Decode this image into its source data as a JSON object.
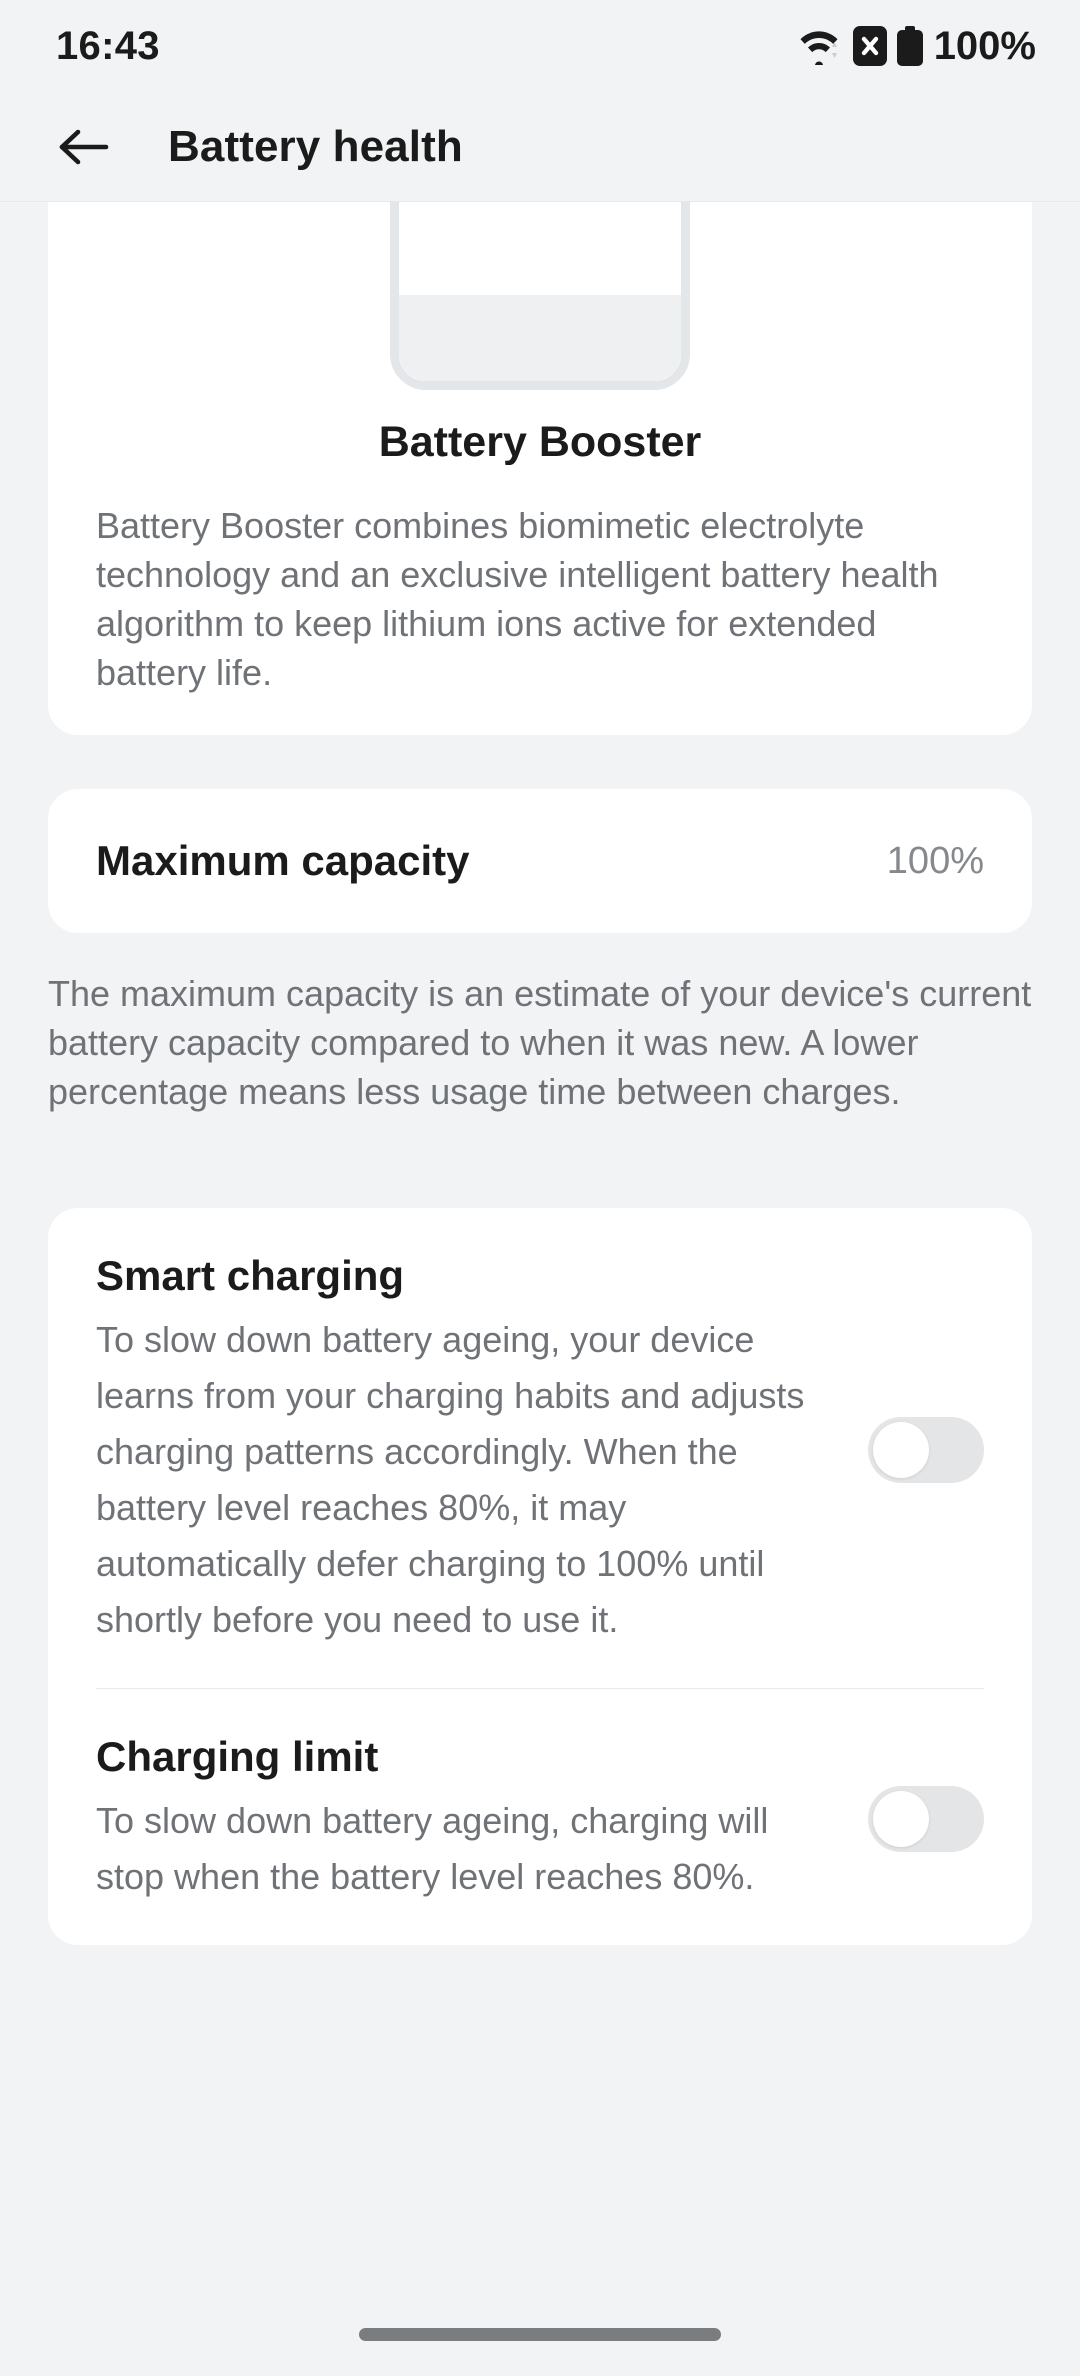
{
  "status_bar": {
    "time": "16:43",
    "battery_percent": "100%",
    "icons": [
      "wifi-icon",
      "sim-error-icon",
      "battery-icon"
    ]
  },
  "app_bar": {
    "back_label": "back-arrow",
    "title": "Battery health"
  },
  "hero": {
    "illustration": "battery-illustration",
    "title": "Battery Booster",
    "description": "Battery Booster combines biomimetic electrolyte technology and an exclusive intelligent battery health algorithm to keep lithium ions active for extended battery life."
  },
  "maximum_capacity": {
    "label": "Maximum capacity",
    "value": "100%",
    "note": "The maximum capacity is an estimate of your device's current battery capacity compared to when it was new. A lower percentage means less usage time between charges."
  },
  "settings": [
    {
      "title": "Smart charging",
      "description": "To slow down battery ageing, your device learns from your charging habits and adjusts charging patterns accordingly. When the battery level reaches 80%, it may automatically defer charging to 100% until shortly before you need to use it.",
      "toggle_state": "off"
    },
    {
      "title": "Charging limit",
      "description": "To slow down battery ageing, charging will stop when the battery level reaches 80%.",
      "toggle_state": "off"
    }
  ],
  "navigation": {
    "gesture_pill": "home-indicator"
  },
  "colors": {
    "background": "#f1f3f4",
    "card": "#ffffff",
    "primary_text": "#1b1b1b",
    "secondary_text": "#6f7276",
    "switch_off_track": "#e3e5e7",
    "switch_knob": "#ffffff",
    "nav_pill": "#7a7d80"
  }
}
